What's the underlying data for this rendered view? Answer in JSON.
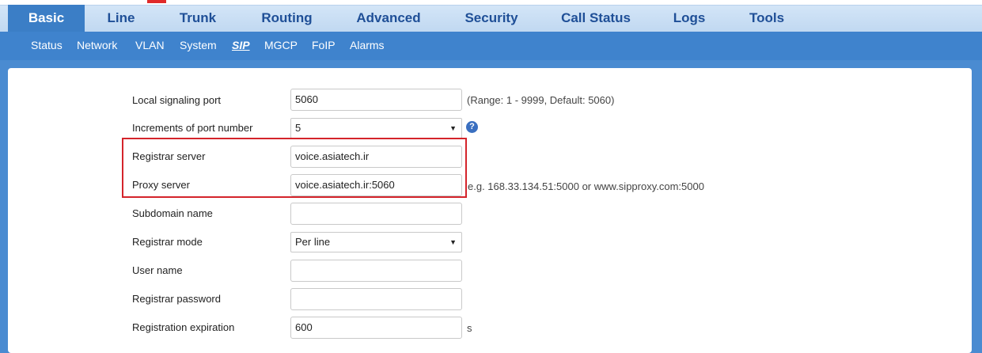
{
  "main_tabs": [
    {
      "label": "Basic",
      "active": true
    },
    {
      "label": "Line"
    },
    {
      "label": "Trunk"
    },
    {
      "label": "Routing"
    },
    {
      "label": "Advanced"
    },
    {
      "label": "Security"
    },
    {
      "label": "Call Status"
    },
    {
      "label": "Logs"
    },
    {
      "label": "Tools"
    }
  ],
  "sub_tabs": [
    {
      "label": "Status"
    },
    {
      "label": "Network"
    },
    {
      "label": "VLAN"
    },
    {
      "label": "System"
    },
    {
      "label": "SIP",
      "active": true
    },
    {
      "label": "MGCP"
    },
    {
      "label": "FoIP"
    },
    {
      "label": "Alarms"
    }
  ],
  "form": {
    "local_port": {
      "label": "Local signaling port",
      "value": "5060",
      "hint": "(Range: 1 - 9999, Default: 5060)"
    },
    "port_increment": {
      "label": "Increments of port number",
      "value": "5"
    },
    "registrar_server": {
      "label": "Registrar server",
      "value": "voice.asiatech.ir"
    },
    "proxy_server": {
      "label": "Proxy server",
      "value": "voice.asiatech.ir:5060",
      "hint": "e.g. 168.33.134.51:5000 or www.sipproxy.com:5000"
    },
    "subdomain": {
      "label": "Subdomain name",
      "value": ""
    },
    "registrar_mode": {
      "label": "Registrar mode",
      "value": "Per line"
    },
    "user_name": {
      "label": "User name",
      "value": ""
    },
    "registrar_password": {
      "label": "Registrar password",
      "value": ""
    },
    "registration_expiration": {
      "label": "Registration expiration",
      "value": "600",
      "unit": "s"
    }
  },
  "colors": {
    "nav_band": "#c8ddf3",
    "active_tab": "#3b7ec6",
    "subnav": "#3f83cd",
    "highlight": "#d4242b"
  },
  "icons": {
    "help": "question-circle-icon",
    "dropdown": "triangle-down"
  }
}
